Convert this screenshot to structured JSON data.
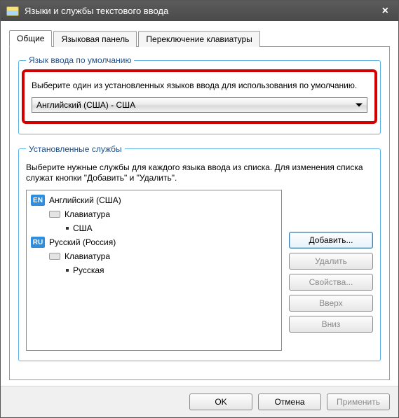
{
  "window": {
    "title": "Языки и службы текстового ввода"
  },
  "tabs": {
    "general": "Общие",
    "langbar": "Языковая панель",
    "switch": "Переключение клавиатуры"
  },
  "default_group": {
    "legend": "Язык ввода по умолчанию",
    "desc": "Выберите один из установленных языков ввода для использования по умолчанию.",
    "selected": "Английский (США) - США"
  },
  "services_group": {
    "legend": "Установленные службы",
    "desc": "Выберите нужные службы для каждого языка ввода из списка. Для изменения списка служат кнопки \"Добавить\" и \"Удалить\".",
    "langs": [
      {
        "code": "EN",
        "name": "Английский (США)",
        "keyboard_label": "Клавиатура",
        "layout": "США"
      },
      {
        "code": "RU",
        "name": "Русский (Россия)",
        "keyboard_label": "Клавиатура",
        "layout": "Русская"
      }
    ],
    "buttons": {
      "add": "Добавить...",
      "remove": "Удалить",
      "props": "Свойства...",
      "up": "Вверх",
      "down": "Вниз"
    }
  },
  "footer": {
    "ok": "OK",
    "cancel": "Отмена",
    "apply": "Применить"
  }
}
